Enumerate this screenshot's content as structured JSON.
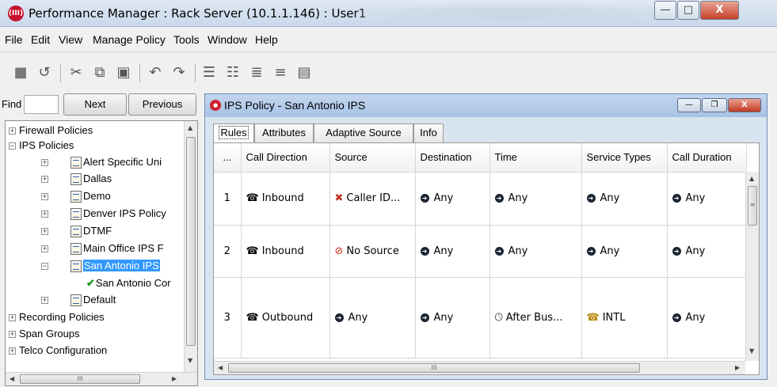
{
  "window": {
    "title": "Performance Manager : Rack Server (10.1.1.146) : User1",
    "app_icon_label": "(III)",
    "minimize_glyph": "—",
    "maximize_glyph": "□",
    "close_glyph": "X"
  },
  "menu": [
    "File",
    "Edit",
    "View",
    "Manage Policy",
    "Tools",
    "Window",
    "Help"
  ],
  "toolbar": {
    "icons": [
      "save-icon",
      "undo-history-icon",
      "cut-icon",
      "copy-icon",
      "paste-icon",
      "undo-icon",
      "redo-icon",
      "add-rule-icon",
      "insert-rule-icon",
      "move-up-icon",
      "move-down-icon",
      "delete-rule-icon"
    ]
  },
  "find": {
    "label": "Find",
    "value": "",
    "next_label": "Next",
    "previous_label": "Previous"
  },
  "tree": {
    "items": [
      {
        "label": "Firewall Policies",
        "level": 0,
        "expander": "+"
      },
      {
        "label": "IPS Policies",
        "level": 0,
        "expander": "−"
      },
      {
        "label": "Alert Specific Uni",
        "level": 1,
        "expander": "+"
      },
      {
        "label": "Dallas",
        "level": 1,
        "expander": "+"
      },
      {
        "label": "Demo",
        "level": 1,
        "expander": "+"
      },
      {
        "label": "Denver IPS Policy",
        "level": 1,
        "expander": "+"
      },
      {
        "label": "DTMF",
        "level": 1,
        "expander": "+"
      },
      {
        "label": "Main Office IPS F",
        "level": 1,
        "expander": "+"
      },
      {
        "label": "San Antonio IPS",
        "level": 1,
        "expander": "−",
        "selected": true
      },
      {
        "label": "San Antonio Cor",
        "level": 2,
        "check": true
      },
      {
        "label": "Default",
        "level": 1,
        "expander": "+"
      },
      {
        "label": "Recording Policies",
        "level": 0,
        "expander": "+"
      },
      {
        "label": "Span Groups",
        "level": 0,
        "expander": "+"
      },
      {
        "label": "Telco Configuration",
        "level": 0,
        "expander": "+"
      }
    ],
    "hscroll_grip": "III"
  },
  "policy_window": {
    "title": "IPS Policy - San Antonio IPS",
    "tabs": [
      "Rules",
      "Attributes",
      "Adaptive Source",
      "Info"
    ],
    "active_tab": "Rules",
    "columns": [
      "...",
      "Call Direction",
      "Source",
      "Destination",
      "Time",
      "Service Types",
      "Call Duration"
    ],
    "rows": [
      {
        "num": "1",
        "direction": "Inbound",
        "source": "Caller ID...",
        "destination": "Any",
        "time": "Any",
        "service": "Any",
        "duration": "Any"
      },
      {
        "num": "2",
        "direction": "Inbound",
        "source": "No Source",
        "destination": "Any",
        "time": "Any",
        "service": "Any",
        "duration": "Any"
      },
      {
        "num": "3",
        "direction": "Outbound",
        "source": "Any",
        "destination": "Any",
        "time": "After Bus...",
        "service": "INTL",
        "duration": "Any"
      }
    ],
    "hscroll_grip": "III",
    "vscroll_grip": "≡"
  }
}
